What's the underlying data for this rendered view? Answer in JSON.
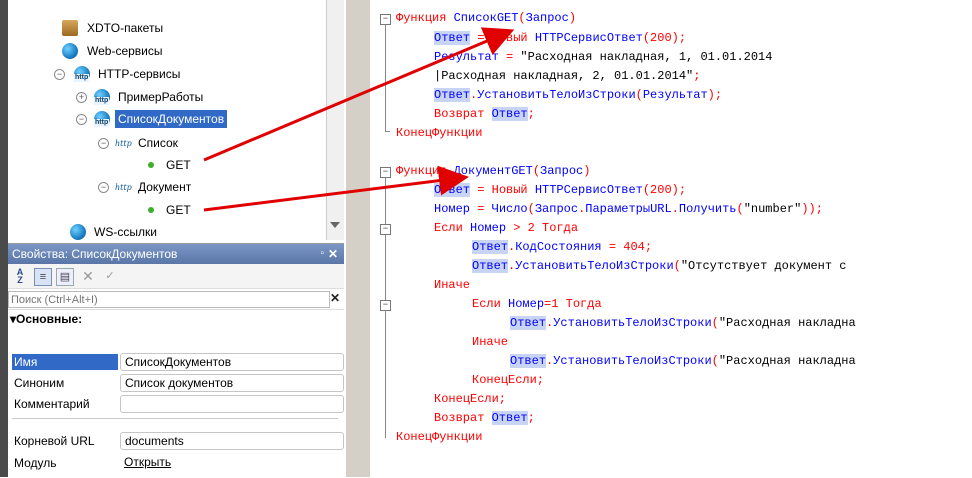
{
  "tree": {
    "items": [
      {
        "label": "XDTO-пакеты"
      },
      {
        "label": "Web-сервисы"
      },
      {
        "label": "HTTP-сервисы"
      },
      {
        "label": "ПримерРаботы"
      },
      {
        "label": "СписокДокументов"
      },
      {
        "label": "Список"
      },
      {
        "label": "GET"
      },
      {
        "label": "Документ"
      },
      {
        "label": "GET"
      },
      {
        "label": "WS-ссылки"
      }
    ],
    "http_tag": "http"
  },
  "properties": {
    "title": "Свойства: СписокДокументов",
    "search_placeholder": "Поиск (Ctrl+Alt+I)",
    "group": "Основные:",
    "rows": [
      {
        "label": "Имя",
        "value": "СписокДокументов"
      },
      {
        "label": "Синоним",
        "value": "Список документов"
      },
      {
        "label": "Комментарий",
        "value": ""
      },
      {
        "label": "Корневой URL",
        "value": "documents"
      },
      {
        "label": "Модуль",
        "value": "Открыть"
      }
    ]
  },
  "code": {
    "lines": [
      "Функция СписокGET(Запрос)",
      "Ответ = Новый HTTPСервисОтвет(200);",
      "Результат = \"Расходная накладная, 1, 01.01.2014",
      "|Расходная накладная, 2, 01.01.2014\";",
      "Ответ.УстановитьТелоИзСтроки(Результат);",
      "Возврат Ответ;",
      "КонецФункции",
      "",
      "Функция ДокументGET(Запрос)",
      "Ответ = Новый HTTPСервисОтвет(200);",
      "Номер = Число(Запрос.ПараметрыURL.Получить(\"number\"));",
      "Если Номер > 2 Тогда",
      "Ответ.КодСостояния = 404;",
      "Ответ.УстановитьТелоИзСтроки(\"Отсутствует документ с",
      "Иначе",
      "Если Номер=1 Тогда",
      "Ответ.УстановитьТелоИзСтроки(\"Расходная накладна",
      "Иначе",
      "Ответ.УстановитьТелоИзСтроки(\"Расходная накладна",
      "КонецЕсли;",
      "КонецЕсли;",
      "Возврат Ответ;",
      "КонецФункции"
    ]
  },
  "colors": {
    "keyword": "#ff0000",
    "identifier": "#0000ff",
    "arrow": "#e00000",
    "selection": "#3169c6"
  }
}
